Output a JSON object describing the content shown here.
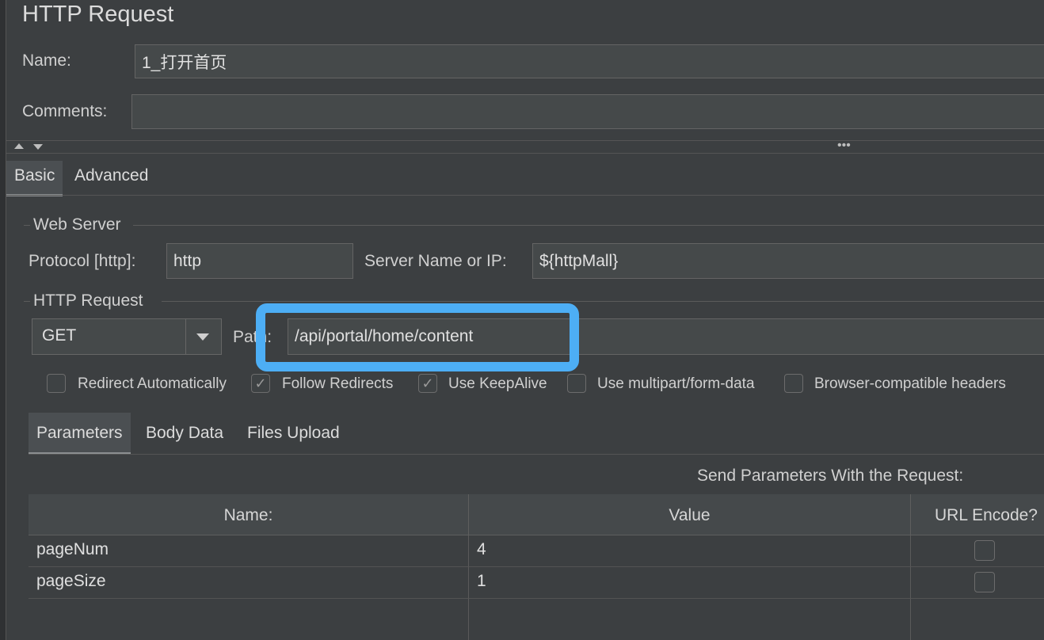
{
  "panel": {
    "title": "HTTP Request",
    "name_label": "Name:",
    "name_value": "1_打开首页",
    "comments_label": "Comments:",
    "comments_value": ""
  },
  "tabs": {
    "basic": "Basic",
    "advanced": "Advanced"
  },
  "web_server": {
    "group_label": "Web Server",
    "protocol_label": "Protocol [http]:",
    "protocol_value": "http",
    "server_label": "Server Name or IP:",
    "server_value": "${httpMall}"
  },
  "http_request": {
    "group_label": "HTTP Request",
    "method": "GET",
    "path_label": "Path:",
    "path_value": "/api/portal/home/content"
  },
  "options": [
    {
      "label": "Redirect Automatically",
      "checked": false
    },
    {
      "label": "Follow Redirects",
      "checked": true
    },
    {
      "label": "Use KeepAlive",
      "checked": true
    },
    {
      "label": "Use multipart/form-data",
      "checked": false
    },
    {
      "label": "Browser-compatible headers",
      "checked": false
    }
  ],
  "subtabs": {
    "parameters": "Parameters",
    "body_data": "Body Data",
    "files_upload": "Files Upload"
  },
  "params": {
    "caption": "Send Parameters With the Request:",
    "headers": [
      "Name:",
      "Value",
      "URL Encode?"
    ],
    "rows": [
      {
        "name": "pageNum",
        "value": "4",
        "encode": false
      },
      {
        "name": "pageSize",
        "value": "1",
        "encode": false
      }
    ]
  },
  "colors": {
    "background": "#3c3f41",
    "highlight": "#4daef5"
  }
}
